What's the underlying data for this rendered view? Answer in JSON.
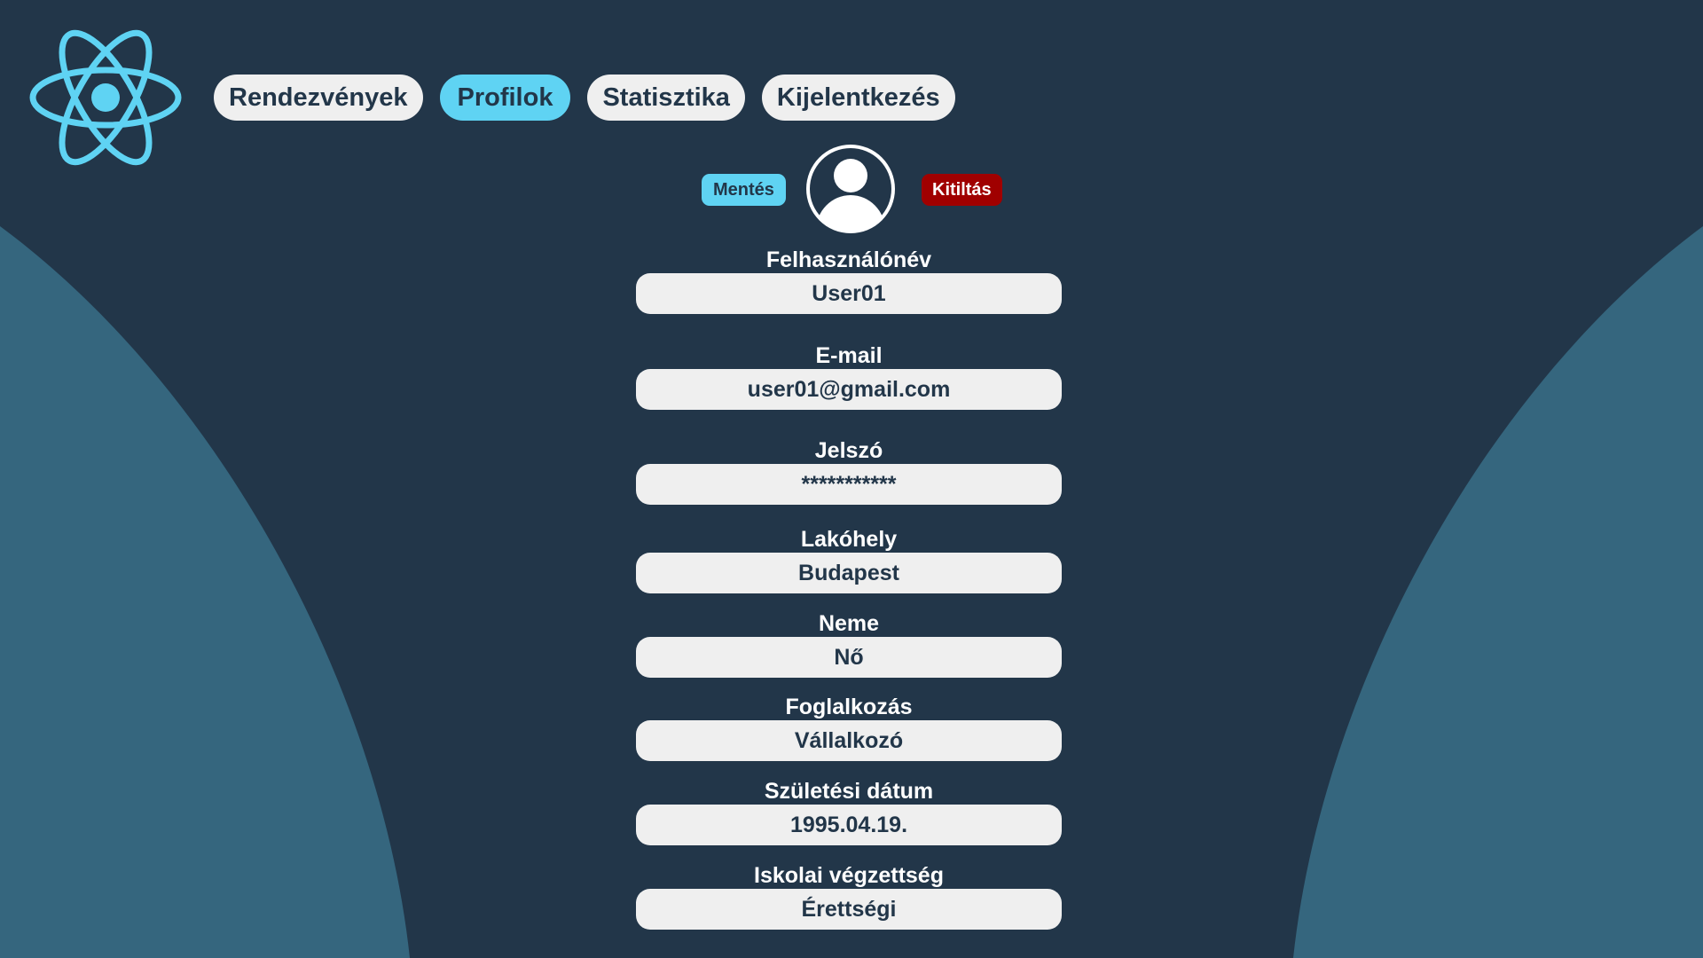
{
  "nav": {
    "items": [
      {
        "label": "Rendezvények",
        "active": false
      },
      {
        "label": "Profilok",
        "active": true
      },
      {
        "label": "Statisztika",
        "active": false
      },
      {
        "label": "Kijelentkezés",
        "active": false
      }
    ]
  },
  "actions": {
    "save_label": "Mentés",
    "ban_label": "Kitiltás"
  },
  "profile": {
    "fields": [
      {
        "label": "Felhasználónév",
        "value": "User01"
      },
      {
        "label": "E-mail",
        "value": "user01@gmail.com"
      },
      {
        "label": "Jelszó",
        "value": "***********"
      },
      {
        "label": "Lakóhely",
        "value": "Budapest"
      },
      {
        "label": "Neme",
        "value": "Nő"
      },
      {
        "label": "Foglalkozás",
        "value": "Vállalkozó"
      },
      {
        "label": "Születési dátum",
        "value": "1995.04.19."
      },
      {
        "label": "Iskolai végzettség",
        "value": "Érettségi"
      }
    ]
  },
  "colors": {
    "background": "#223649",
    "side_shape": "#35667e",
    "accent": "#5fd3f3",
    "danger": "#a00000",
    "field_bg": "#efefef",
    "text_dark": "#223649"
  },
  "icons": {
    "logo": "react-atom-icon",
    "avatar": "user-avatar-icon"
  }
}
